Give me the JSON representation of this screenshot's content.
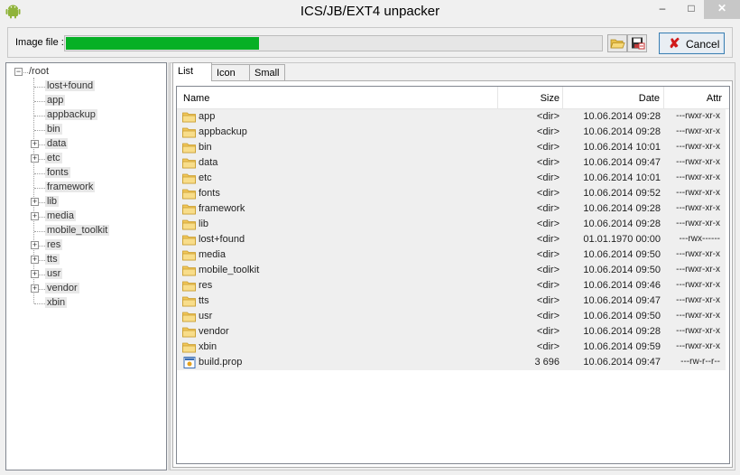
{
  "window": {
    "title": "ICS/JB/EXT4 unpacker",
    "controls": {
      "minimize": "–",
      "maximize": "□",
      "close": "✕"
    }
  },
  "toolbar": {
    "image_label": "Image file :",
    "progress_percent": 36,
    "open_icon": "folder-open-icon",
    "save_icon": "save-icon",
    "cancel_label": "Cancel",
    "cancel_icon": "red-x-icon",
    "progress_color": "#06b025"
  },
  "tree": {
    "root": "/root",
    "items": [
      {
        "label": "lost+found",
        "expandable": false
      },
      {
        "label": "app",
        "expandable": false
      },
      {
        "label": "appbackup",
        "expandable": false
      },
      {
        "label": "bin",
        "expandable": false
      },
      {
        "label": "data",
        "expandable": true
      },
      {
        "label": "etc",
        "expandable": true
      },
      {
        "label": "fonts",
        "expandable": false
      },
      {
        "label": "framework",
        "expandable": false
      },
      {
        "label": "lib",
        "expandable": true
      },
      {
        "label": "media",
        "expandable": true
      },
      {
        "label": "mobile_toolkit",
        "expandable": false
      },
      {
        "label": "res",
        "expandable": true
      },
      {
        "label": "tts",
        "expandable": true
      },
      {
        "label": "usr",
        "expandable": true
      },
      {
        "label": "vendor",
        "expandable": true
      },
      {
        "label": "xbin",
        "expandable": false
      }
    ]
  },
  "tabs": [
    {
      "label": "List",
      "active": true
    },
    {
      "label": "Icon",
      "active": false
    },
    {
      "label": "Small",
      "active": false
    }
  ],
  "list": {
    "columns": {
      "name": "Name",
      "size": "Size",
      "date": "Date",
      "attr": "Attr"
    },
    "rows": [
      {
        "name": "app",
        "size": "<dir>",
        "date": "10.06.2014 09:28",
        "attr": "---rwxr-xr-x",
        "icon": "folder-icon"
      },
      {
        "name": "appbackup",
        "size": "<dir>",
        "date": "10.06.2014 09:28",
        "attr": "---rwxr-xr-x",
        "icon": "folder-icon"
      },
      {
        "name": "bin",
        "size": "<dir>",
        "date": "10.06.2014 10:01",
        "attr": "---rwxr-xr-x",
        "icon": "folder-icon"
      },
      {
        "name": "data",
        "size": "<dir>",
        "date": "10.06.2014 09:47",
        "attr": "---rwxr-xr-x",
        "icon": "folder-icon"
      },
      {
        "name": "etc",
        "size": "<dir>",
        "date": "10.06.2014 10:01",
        "attr": "---rwxr-xr-x",
        "icon": "folder-icon"
      },
      {
        "name": "fonts",
        "size": "<dir>",
        "date": "10.06.2014 09:52",
        "attr": "---rwxr-xr-x",
        "icon": "folder-icon"
      },
      {
        "name": "framework",
        "size": "<dir>",
        "date": "10.06.2014 09:28",
        "attr": "---rwxr-xr-x",
        "icon": "folder-icon"
      },
      {
        "name": "lib",
        "size": "<dir>",
        "date": "10.06.2014 09:28",
        "attr": "---rwxr-xr-x",
        "icon": "folder-icon"
      },
      {
        "name": "lost+found",
        "size": "<dir>",
        "date": "01.01.1970 00:00",
        "attr": "---rwx------",
        "icon": "folder-icon"
      },
      {
        "name": "media",
        "size": "<dir>",
        "date": "10.06.2014 09:50",
        "attr": "---rwxr-xr-x",
        "icon": "folder-icon"
      },
      {
        "name": "mobile_toolkit",
        "size": "<dir>",
        "date": "10.06.2014 09:50",
        "attr": "---rwxr-xr-x",
        "icon": "folder-icon"
      },
      {
        "name": "res",
        "size": "<dir>",
        "date": "10.06.2014 09:46",
        "attr": "---rwxr-xr-x",
        "icon": "folder-icon"
      },
      {
        "name": "tts",
        "size": "<dir>",
        "date": "10.06.2014 09:47",
        "attr": "---rwxr-xr-x",
        "icon": "folder-icon"
      },
      {
        "name": "usr",
        "size": "<dir>",
        "date": "10.06.2014 09:50",
        "attr": "---rwxr-xr-x",
        "icon": "folder-icon"
      },
      {
        "name": "vendor",
        "size": "<dir>",
        "date": "10.06.2014 09:28",
        "attr": "---rwxr-xr-x",
        "icon": "folder-icon"
      },
      {
        "name": "xbin",
        "size": "<dir>",
        "date": "10.06.2014 09:59",
        "attr": "---rwxr-xr-x",
        "icon": "folder-icon"
      },
      {
        "name": "build.prop",
        "size": "3 696",
        "date": "10.06.2014 09:47",
        "attr": "---rw-r--r--",
        "icon": "file-icon"
      }
    ]
  }
}
